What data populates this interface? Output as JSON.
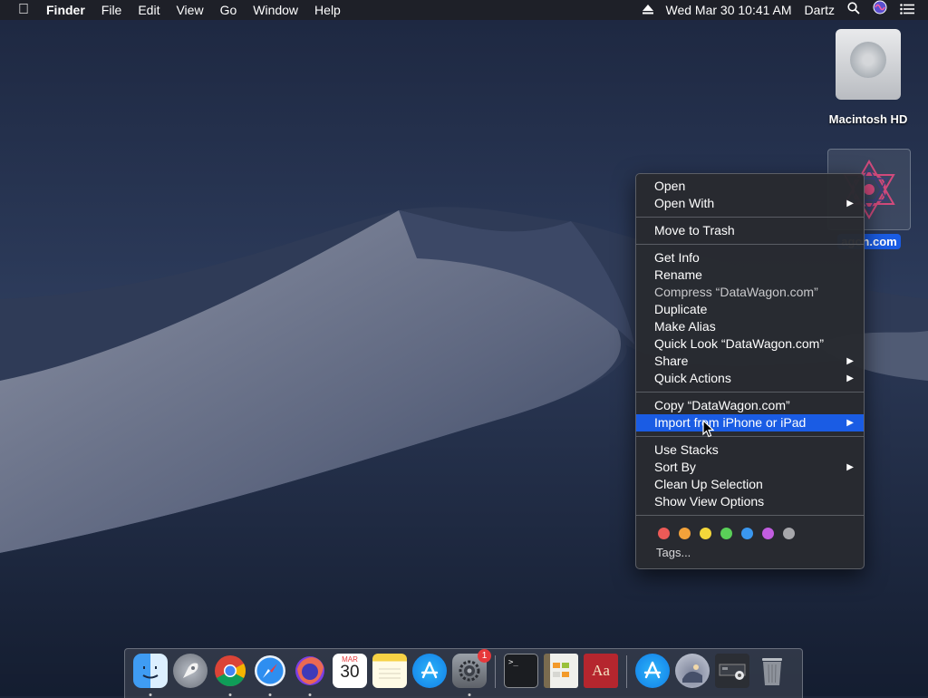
{
  "menubar": {
    "apple_icon": "apple-logo-icon",
    "app_name": "Finder",
    "menus": [
      "File",
      "Edit",
      "View",
      "Go",
      "Window",
      "Help"
    ],
    "datetime": "Wed Mar 30  10:41 AM",
    "user": "Dartz"
  },
  "desktop": {
    "macintosh_hd_label": "Macintosh HD",
    "selected_item_label": "agon.com"
  },
  "context_menu": {
    "open": "Open",
    "open_with": "Open With",
    "move_to_trash": "Move to Trash",
    "get_info": "Get Info",
    "rename": "Rename",
    "compress": "Compress “DataWagon.com”",
    "duplicate": "Duplicate",
    "make_alias": "Make Alias",
    "quick_look": "Quick Look “DataWagon.com”",
    "share": "Share",
    "quick_actions": "Quick Actions",
    "copy": "Copy “DataWagon.com”",
    "import_iphone": "Import from iPhone or iPad",
    "use_stacks": "Use Stacks",
    "sort_by": "Sort By",
    "clean_up": "Clean Up Selection",
    "show_view_options": "Show View Options",
    "tags_label": "Tags...",
    "tag_colors": [
      "#ed5a57",
      "#f3a23a",
      "#f4d73a",
      "#5ad058",
      "#3a97ef",
      "#c25de0",
      "#a7a7ab"
    ]
  },
  "dock": {
    "calendar_month": "MAR",
    "calendar_day": "30",
    "dictionary_glyph": "Aa",
    "system_prefs_badge": "1",
    "terminal_glyph": ">_",
    "items": [
      "finder-icon",
      "launchpad-icon",
      "chrome-icon",
      "safari-icon",
      "firefox-icon",
      "calendar-icon",
      "notes-icon",
      "app-store-icon",
      "system-preferences-icon",
      "terminal-icon",
      "library-icon",
      "dictionary-icon",
      "app-store-downloads-icon",
      "user-folder-icon",
      "disk-utility-icon",
      "trash-icon"
    ]
  }
}
